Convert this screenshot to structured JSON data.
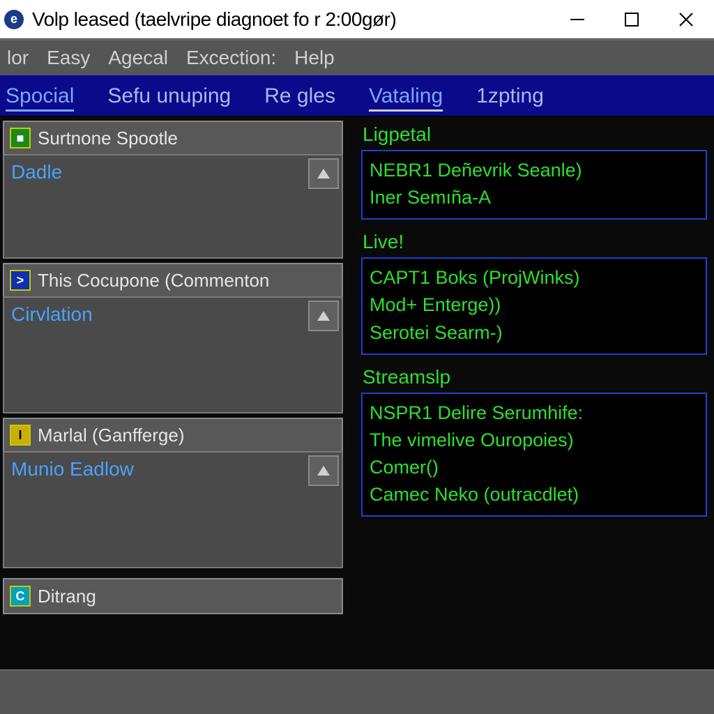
{
  "title": "Volp leased (taelvripe diagnoet fo r 2:00gør)",
  "menubar": [
    "lor",
    "Easy",
    "Agecal",
    "Excection:",
    "Help"
  ],
  "tabs": [
    {
      "label": "Spocial",
      "state": "active"
    },
    {
      "label": "Sefu unuping",
      "state": "plain"
    },
    {
      "label": "Re gles",
      "state": "plain"
    },
    {
      "label": "Vataling",
      "state": "sel"
    },
    {
      "label": "1zpting",
      "state": "plain"
    }
  ],
  "left_panels": [
    {
      "icon": "pi-green",
      "glyph": "■",
      "title": "Surtnone Spootle",
      "link": "Dadle",
      "body_h": "short"
    },
    {
      "icon": "pi-blue",
      "glyph": ">",
      "title": "This Cocupone (Commenton",
      "link": "Cirvlation",
      "body_h": "tall"
    },
    {
      "icon": "pi-yell",
      "glyph": "I",
      "title": "Marlal (Ganfferge)",
      "link": "Munio Eadlow",
      "body_h": "tall"
    }
  ],
  "left_mini": {
    "icon": "pi-cyan",
    "glyph": "C",
    "title": "Ditrang"
  },
  "right_groups": [
    {
      "title": "Ligpetal",
      "lines": [
        "NEBR1 Deñevrik Seanle)",
        "Iner Semıña-A"
      ]
    },
    {
      "title": "Live!",
      "lines": [
        "CAPT1 Boks (ProjWinks)",
        "Mod+ Enterge))",
        "Serotei Searm-)"
      ]
    },
    {
      "title": "Streamslp",
      "lines": [
        "NSPR1 Delire Serumhife:",
        "The vimelive Ouropoies)",
        "Comer()",
        "Camec Neko (outracdlet)"
      ]
    }
  ]
}
